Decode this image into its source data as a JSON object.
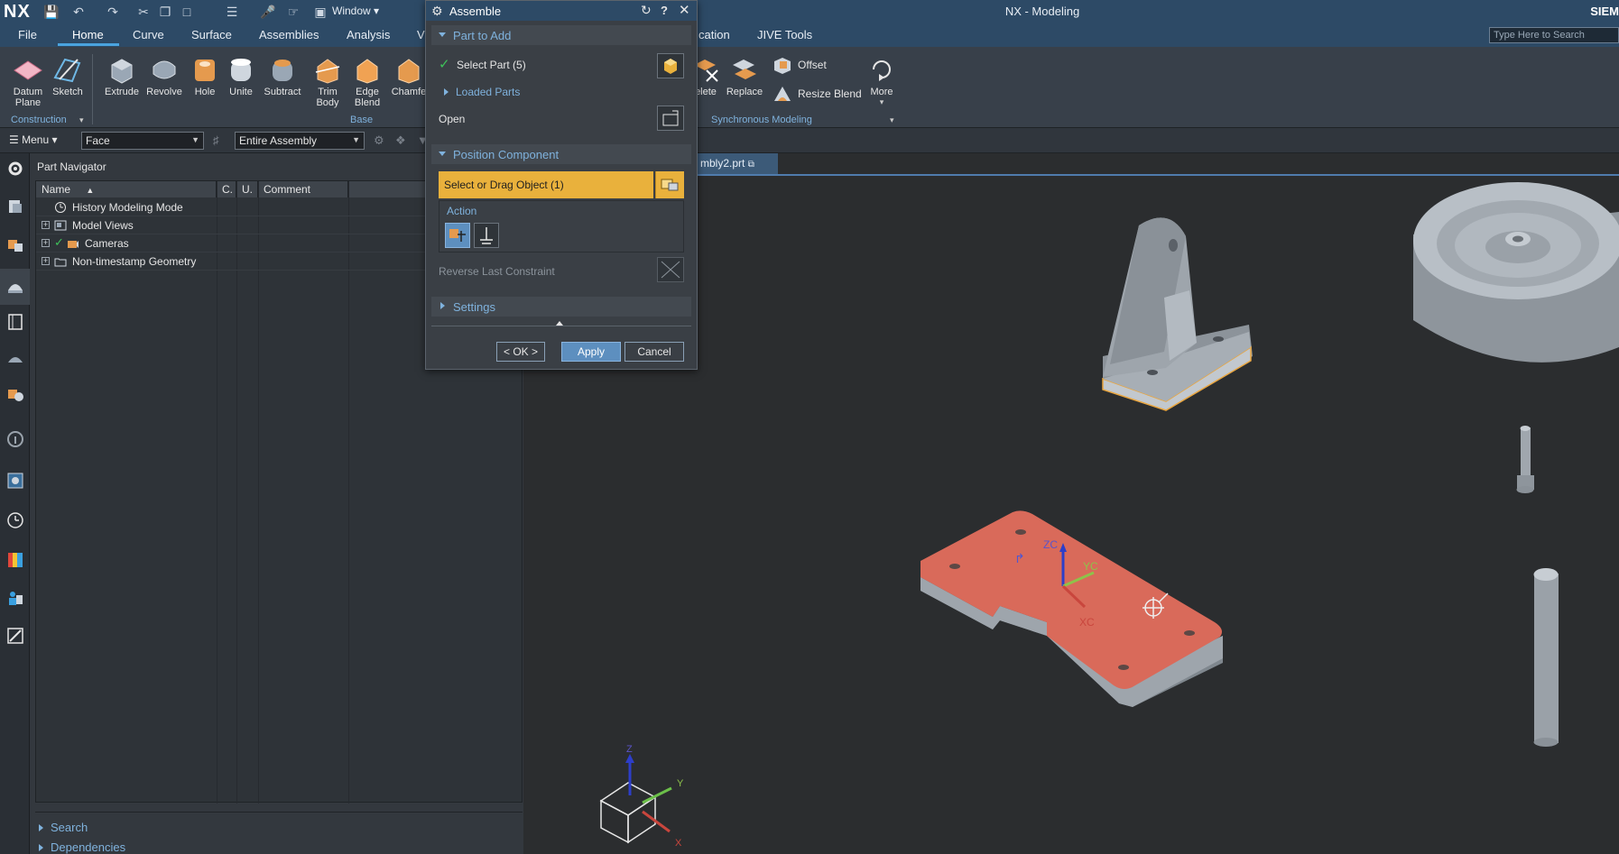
{
  "titlebar": {
    "logo": "NX",
    "window_menu": "Window",
    "title": "NX - Modeling",
    "brand": "SIEM"
  },
  "menu_tabs": [
    {
      "label": "File"
    },
    {
      "label": "Home",
      "active": true
    },
    {
      "label": "Curve"
    },
    {
      "label": "Surface"
    },
    {
      "label": "Assemblies"
    },
    {
      "label": "Analysis"
    },
    {
      "label": "V"
    },
    {
      "label": "cation"
    },
    {
      "label": "JIVE Tools"
    }
  ],
  "search": {
    "placeholder": "Type Here to Search"
  },
  "ribbon": {
    "buttons": [
      {
        "label": "Datum\nPlane",
        "icon": "datum-plane-icon"
      },
      {
        "label": "Sketch",
        "icon": "sketch-icon"
      },
      {
        "label": "Extrude",
        "icon": "extrude-icon"
      },
      {
        "label": "Revolve",
        "icon": "revolve-icon"
      },
      {
        "label": "Hole",
        "icon": "hole-icon"
      },
      {
        "label": "Unite",
        "icon": "unite-icon"
      },
      {
        "label": "Subtract",
        "icon": "subtract-icon"
      },
      {
        "label": "Trim\nBody",
        "icon": "trim-body-icon"
      },
      {
        "label": "Edge\nBlend",
        "icon": "edge-blend-icon"
      },
      {
        "label": "Chamfe",
        "icon": "chamfer-icon"
      }
    ],
    "right_buttons": {
      "delete": "elete",
      "replace": "Replace",
      "offset": "Offset",
      "resize_blend": "Resize Blend",
      "more": "More"
    },
    "groups": {
      "construction": "Construction",
      "base": "Base",
      "synchronous": "Synchronous Modeling"
    }
  },
  "selection_bar": {
    "menu": "Menu",
    "filter": "Face",
    "scope": "Entire Assembly"
  },
  "navigator": {
    "title": "Part Navigator",
    "columns": [
      "Name",
      "C.",
      "U.",
      "Comment"
    ],
    "rows": [
      {
        "label": "History Modeling Mode",
        "icon": "clock-icon"
      },
      {
        "label": "Model Views",
        "icon": "views-icon"
      },
      {
        "label": "Cameras",
        "icon": "camera-icon"
      },
      {
        "label": "Non-timestamp Geometry",
        "icon": "folder-icon"
      }
    ],
    "sections": [
      "Search",
      "Dependencies"
    ]
  },
  "graphics": {
    "tab_label": "mbly2.prt",
    "axes": {
      "zc": "ZC",
      "yc": "YC",
      "xc": "XC",
      "z": "Z",
      "y": "Y",
      "x": "X"
    }
  },
  "dialog": {
    "title": "Assemble",
    "part_to_add": "Part to Add",
    "select_part": "Select Part (5)",
    "loaded_parts": "Loaded Parts",
    "open": "Open",
    "position_component": "Position Component",
    "select_drag": "Select or Drag Object (1)",
    "action": "Action",
    "reverse_last": "Reverse Last Constraint",
    "settings": "Settings",
    "ok": "< OK >",
    "apply": "Apply",
    "cancel": "Cancel"
  },
  "colors": {
    "title_bar": "#2d4a66",
    "accent": "#7fb2dd",
    "selected_part": "#d96a5a",
    "highlight": "#e9b13c"
  }
}
